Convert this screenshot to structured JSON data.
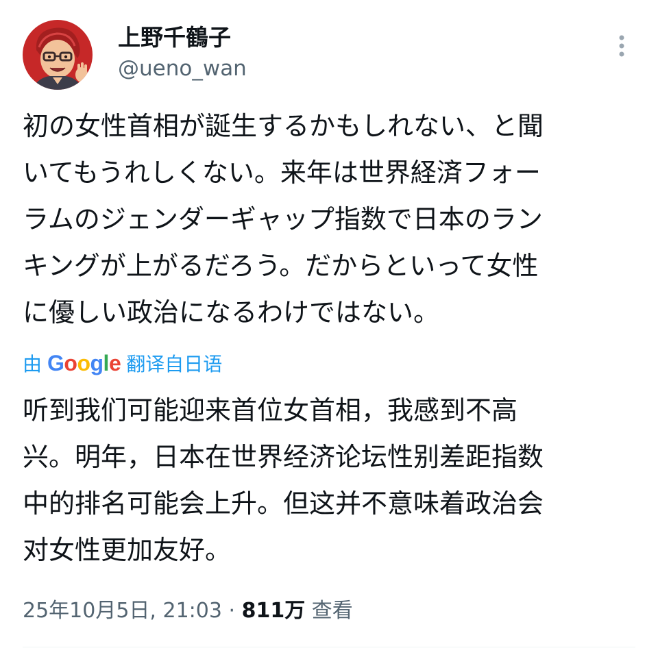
{
  "author": {
    "display_name": "上野千鶴子",
    "handle": "@ueno_wan",
    "avatar_icon": "cartoon-avatar-icon"
  },
  "menu": {
    "icon": "more-vertical-icon"
  },
  "post": {
    "original_lines": [
      "初の女性首相が誕生するかもしれない、と聞",
      "いてもうれしくない。来年は世界経済フォー",
      "ラムのジェンダーギャップ指数で日本のラン",
      "キングが上がるだろう。だからといって女性",
      "に優しい政治になるわけではない。"
    ],
    "translation": {
      "prefix": "由",
      "brand": "Google",
      "suffix": "翻译自日语"
    },
    "translated_lines": [
      "听到我们可能迎来首位女首相，我感到不高",
      "兴。明年，日本在世界经济论坛性别差距指数",
      "中的排名可能会上升。但这并不意味着政治会",
      "对女性更加友好。"
    ]
  },
  "meta": {
    "timestamp": "25年10月5日, 21:03",
    "separator": "·",
    "views_count": "811万",
    "views_label": "查看"
  },
  "colors": {
    "text_primary": "#0f1419",
    "text_secondary": "#536471",
    "link_blue": "#1d9bf0",
    "google_blue": "#4285F4",
    "google_red": "#EA4335",
    "google_yellow": "#FBBC05",
    "google_green": "#34A853",
    "avatar_bg": "#c62828"
  }
}
